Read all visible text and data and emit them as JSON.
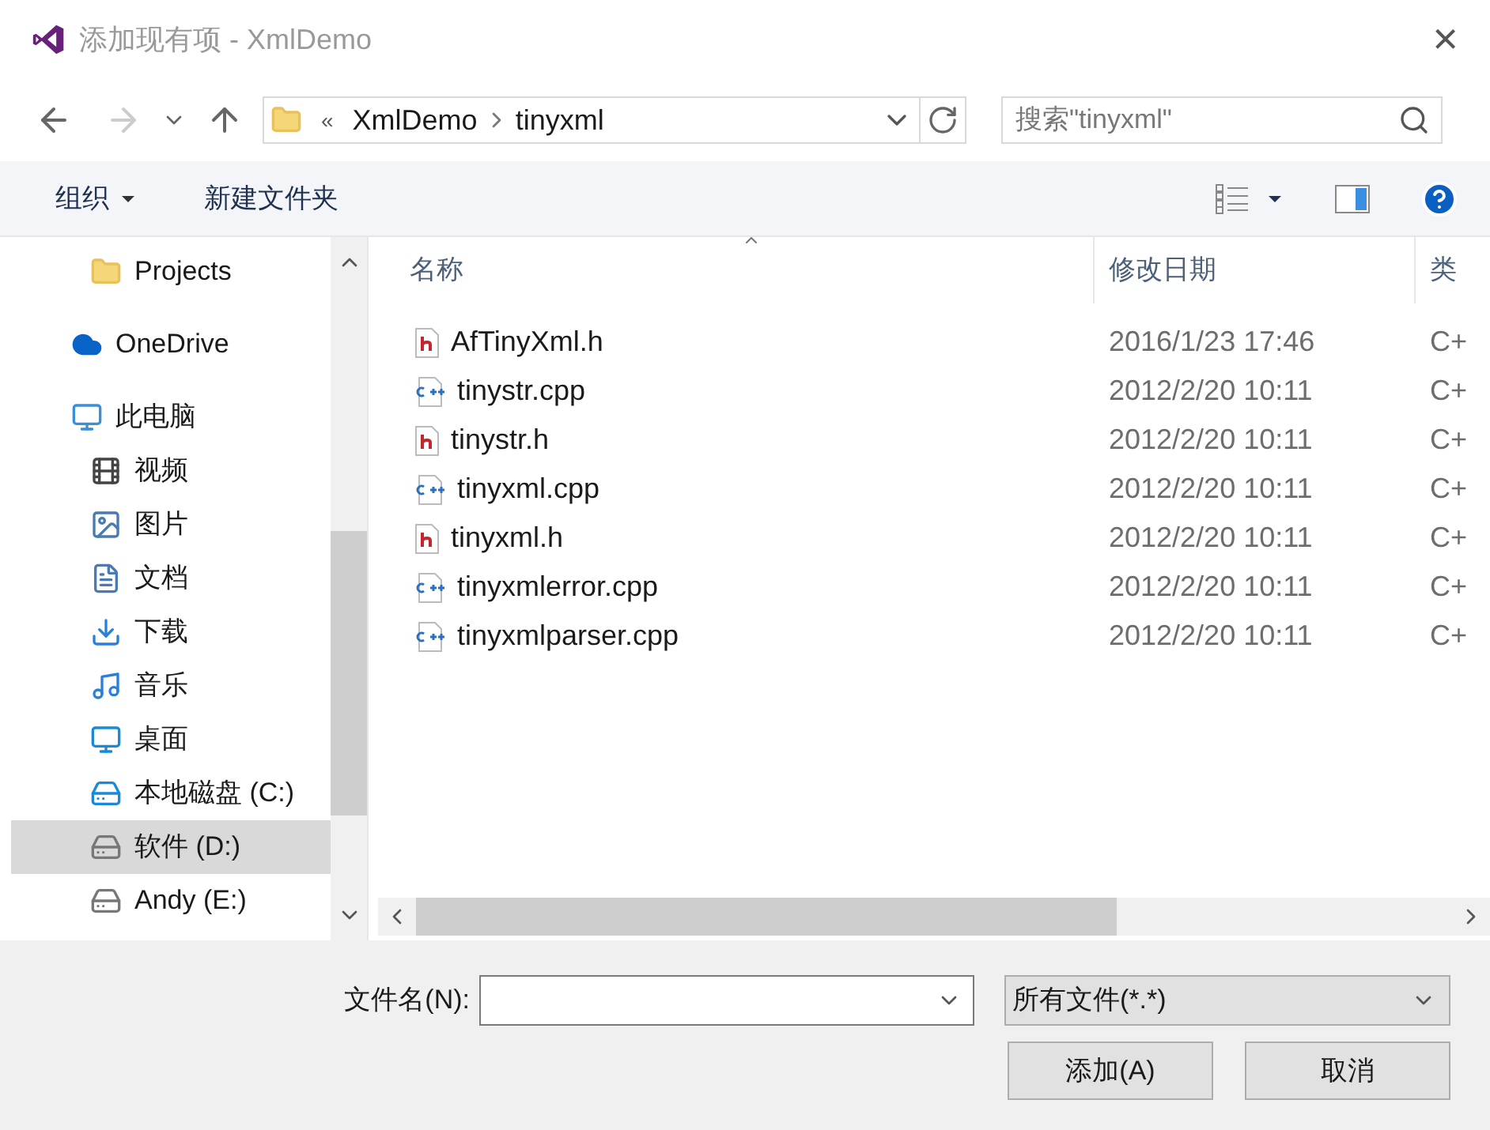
{
  "window": {
    "title": "添加现有项 - XmlDemo",
    "close": "×"
  },
  "nav": {
    "breadcrumb_prefix": "«",
    "path": [
      "XmlDemo",
      "tinyxml"
    ],
    "search": {
      "placeholder": "搜索\"tinyxml\""
    }
  },
  "toolbar": {
    "organize": "组织",
    "new_folder": "新建文件夹"
  },
  "sidebar": {
    "items": [
      {
        "label": "Projects",
        "kind": "folder",
        "selected": false
      },
      {
        "label": "OneDrive",
        "kind": "cloud",
        "selected": false
      },
      {
        "label": "此电脑",
        "kind": "pc",
        "selected": false
      },
      {
        "label": "视频",
        "kind": "video",
        "selected": false
      },
      {
        "label": "图片",
        "kind": "pictures",
        "selected": false
      },
      {
        "label": "文档",
        "kind": "documents",
        "selected": false
      },
      {
        "label": "下载",
        "kind": "downloads",
        "selected": false
      },
      {
        "label": "音乐",
        "kind": "music",
        "selected": false
      },
      {
        "label": "桌面",
        "kind": "desktop",
        "selected": false
      },
      {
        "label": "本地磁盘 (C:)",
        "kind": "system-drive",
        "selected": false
      },
      {
        "label": "软件 (D:)",
        "kind": "drive",
        "selected": true
      },
      {
        "label": "Andy (E:)",
        "kind": "drive",
        "selected": false
      }
    ]
  },
  "table": {
    "columns": [
      "名称",
      "修改日期",
      "类"
    ],
    "rows": [
      {
        "name": "AfTinyXml.h",
        "kind": "h",
        "date": "2016/1/23 17:46",
        "column_3": "C+"
      },
      {
        "name": "tinystr.cpp",
        "kind": "cpp",
        "date": "2012/2/20 10:11",
        "column_3": "C+"
      },
      {
        "name": "tinystr.h",
        "kind": "h",
        "date": "2012/2/20 10:11",
        "column_3": "C+"
      },
      {
        "name": "tinyxml.cpp",
        "kind": "cpp",
        "date": "2012/2/20 10:11",
        "column_3": "C+"
      },
      {
        "name": "tinyxml.h",
        "kind": "h",
        "date": "2012/2/20 10:11",
        "column_3": "C+"
      },
      {
        "name": "tinyxmlerror.cpp",
        "kind": "cpp",
        "date": "2012/2/20 10:11",
        "column_3": "C+"
      },
      {
        "name": "tinyxmlparser.cpp",
        "kind": "cpp",
        "date": "2012/2/20 10:11",
        "column_3": "C+"
      }
    ]
  },
  "footer": {
    "filename_label": "文件名(N):",
    "filter": "所有文件(*.*)",
    "buttons": [
      "添加(A)",
      "取消"
    ]
  }
}
